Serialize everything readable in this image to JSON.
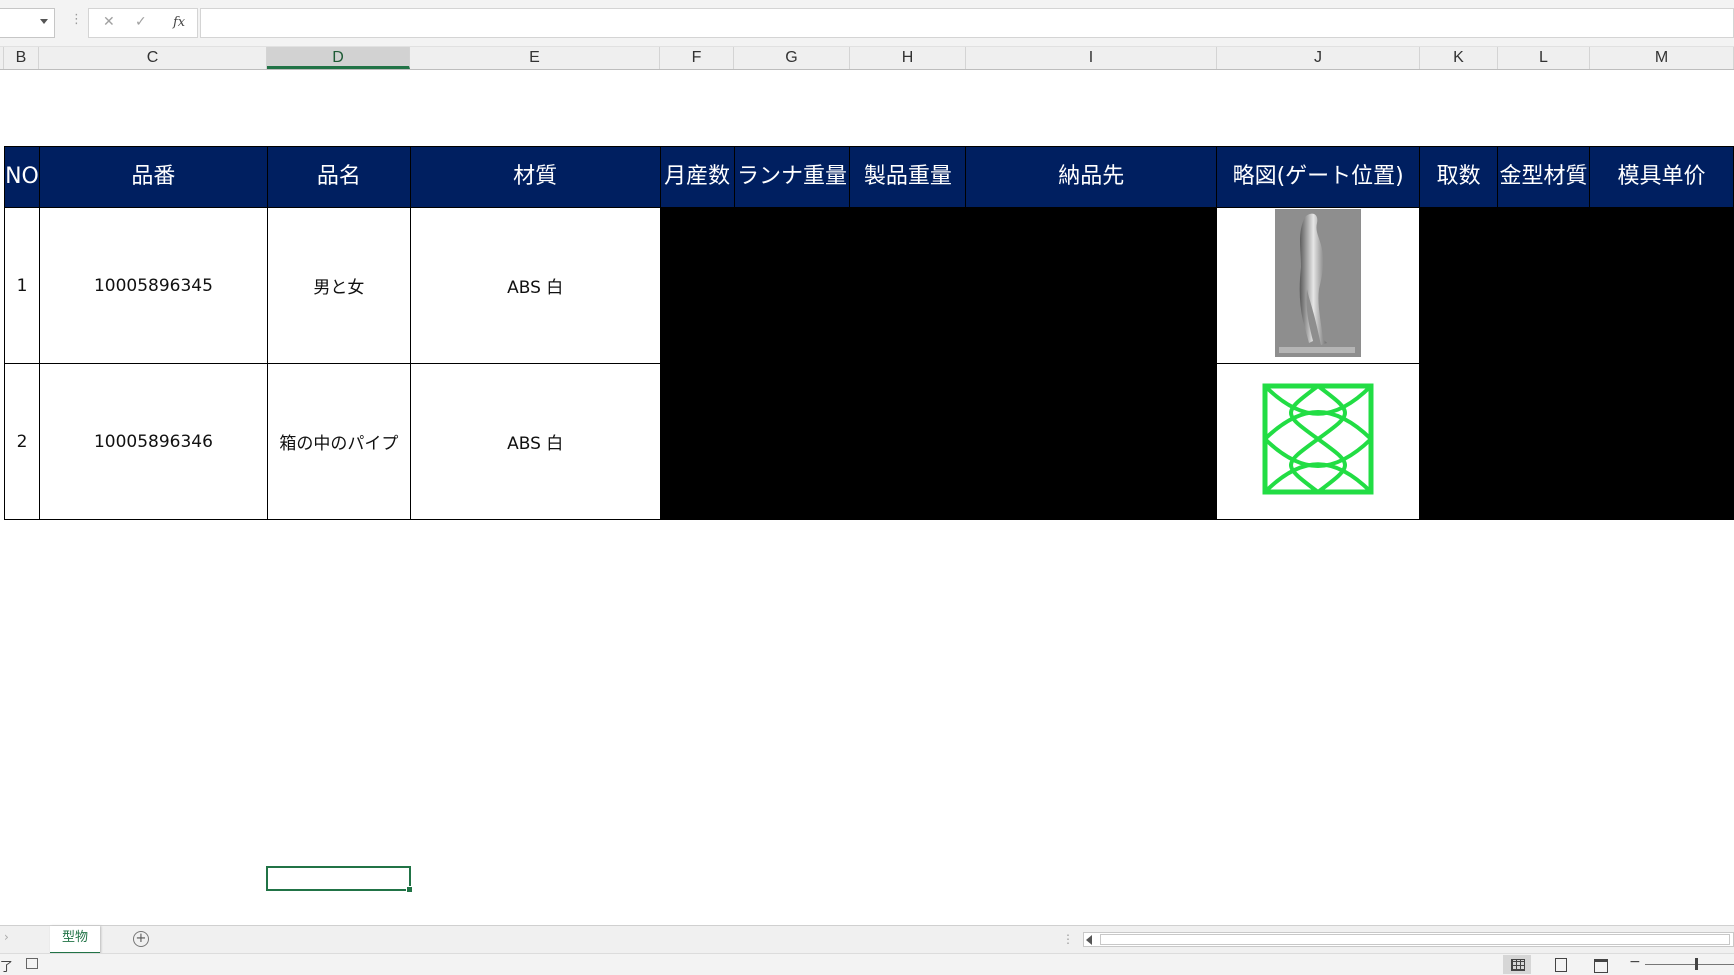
{
  "formula_bar": {
    "name_box": "",
    "cancel_symbol": "✕",
    "enter_symbol": "✓",
    "fx_label": "fx",
    "formula": ""
  },
  "columns": [
    {
      "label": "B"
    },
    {
      "label": "C"
    },
    {
      "label": "D",
      "selected": true
    },
    {
      "label": "E"
    },
    {
      "label": "F"
    },
    {
      "label": "G"
    },
    {
      "label": "H"
    },
    {
      "label": "I"
    },
    {
      "label": "J"
    },
    {
      "label": "K"
    },
    {
      "label": "L"
    },
    {
      "label": "M"
    }
  ],
  "table": {
    "headers": [
      "NO",
      "品番",
      "品名",
      "材質",
      "月産数",
      "ランナ重量",
      "製品重量",
      "納品先",
      "略図(ゲート位置)",
      "取数",
      "金型材質",
      "模具单价"
    ],
    "rows": [
      {
        "no": "1",
        "part_number": "10005896345",
        "part_name": "男と女",
        "material": "ABS 白",
        "diagram": "figure-sketch"
      },
      {
        "no": "2",
        "part_number": "10005896346",
        "part_name": "箱の中のパイプ",
        "material": "ABS 白",
        "diagram": "green-lattice-sketch"
      }
    ],
    "header_color": "#001f60",
    "diagram_green": "#22dd44"
  },
  "sheet_tabs": {
    "active_tab": "型物",
    "add_symbol": "+"
  },
  "status_bar": {
    "status_text": "了"
  }
}
